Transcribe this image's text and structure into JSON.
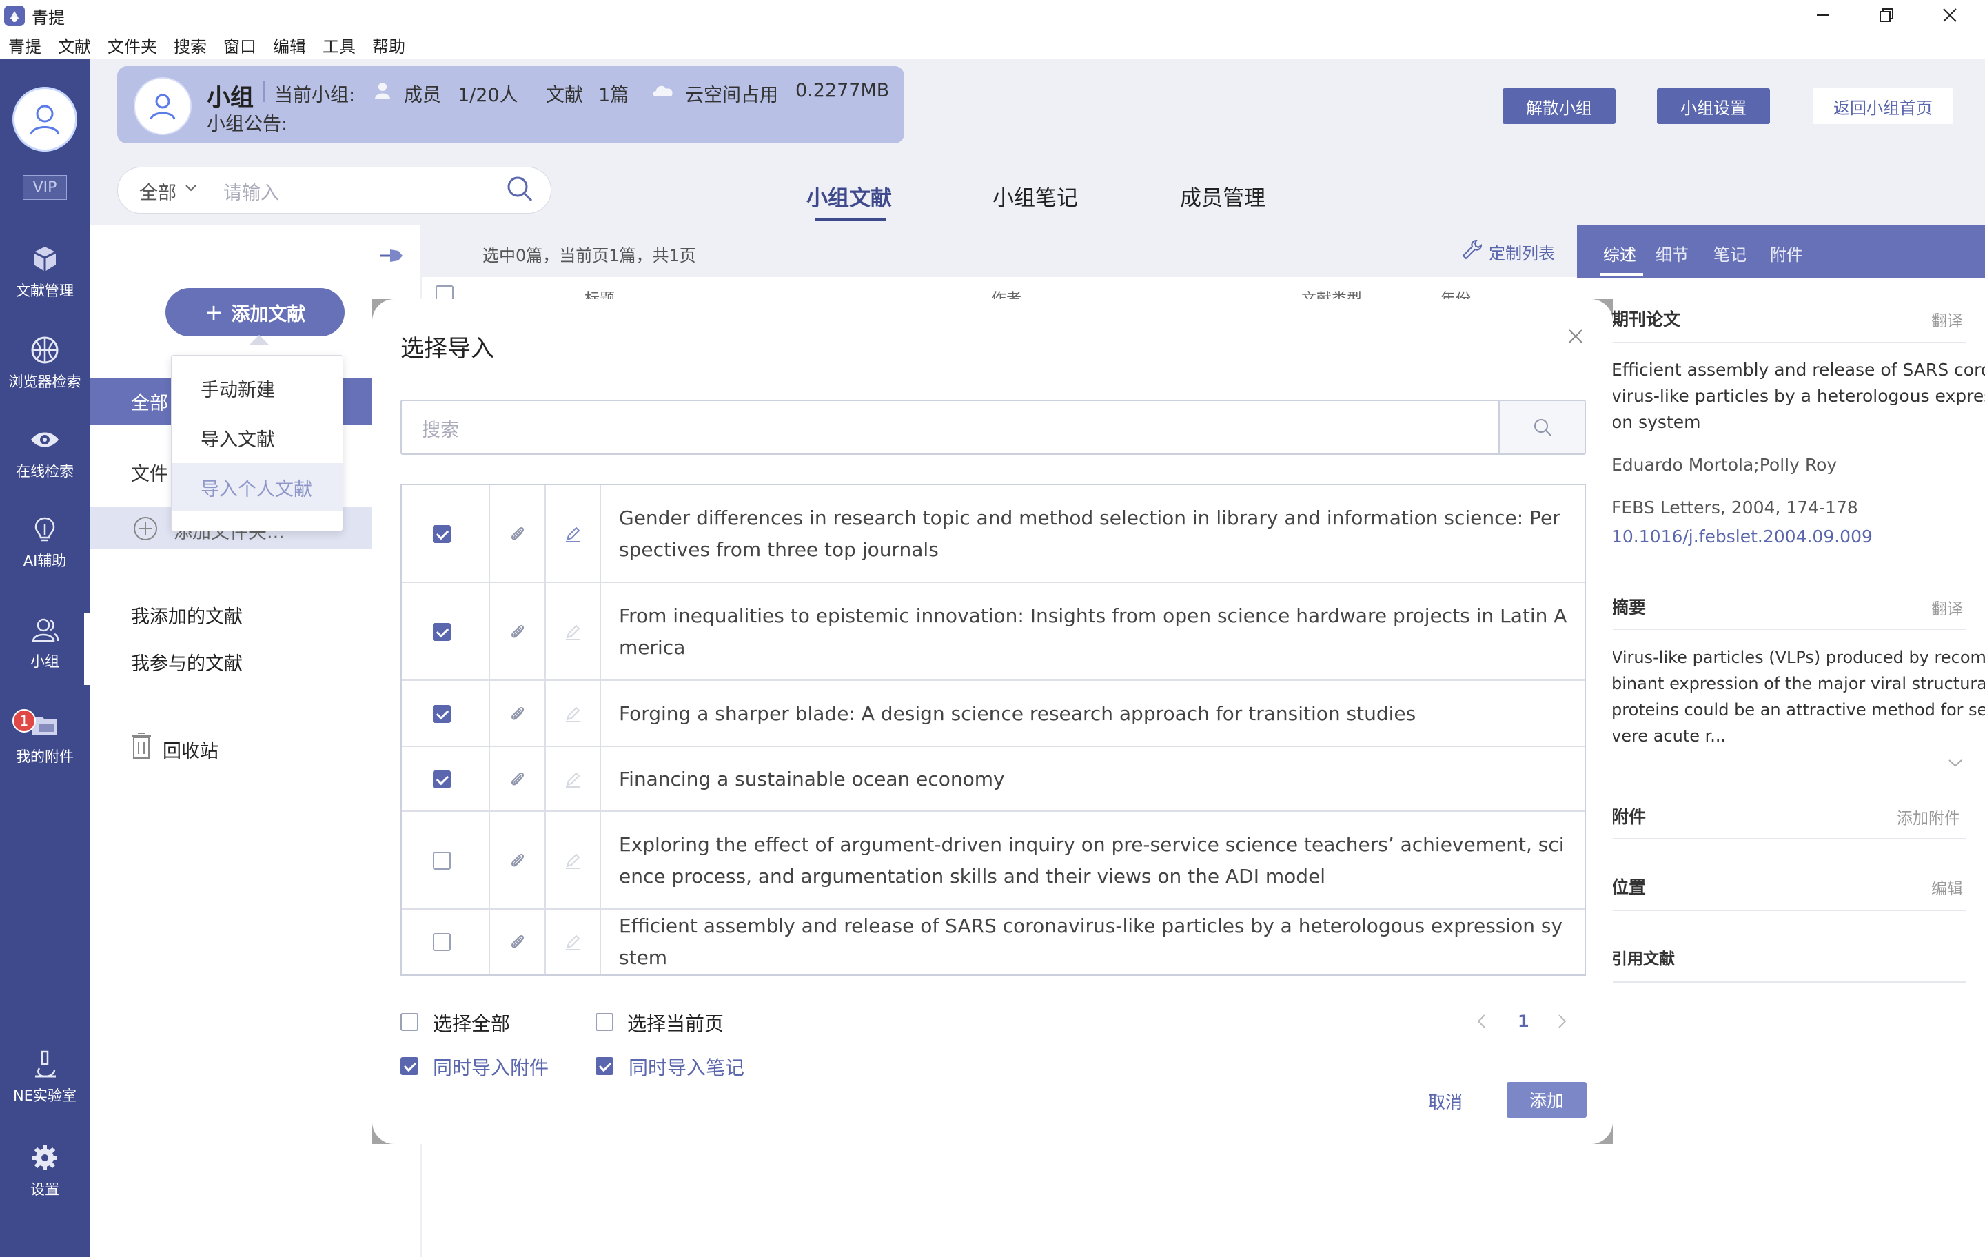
{
  "window": {
    "title": "青提"
  },
  "menu": [
    "青提",
    "文献",
    "文件夹",
    "搜索",
    "窗口",
    "编辑",
    "工具",
    "帮助"
  ],
  "nav": {
    "vip": "VIP",
    "items": [
      {
        "label": "文献管理",
        "icon": "cube-icon"
      },
      {
        "label": "浏览器检索",
        "icon": "basketball-icon"
      },
      {
        "label": "在线检索",
        "icon": "eye-icon"
      },
      {
        "label": "AI辅助",
        "icon": "bulb-icon"
      },
      {
        "label": "小组",
        "icon": "group-icon"
      },
      {
        "label": "我的附件",
        "icon": "folder-icon"
      },
      {
        "label": "NE实验室",
        "icon": "microscope-icon"
      },
      {
        "label": "设置",
        "icon": "gear-icon"
      }
    ],
    "attachments_badge": "1"
  },
  "group": {
    "name": "小组",
    "current_label": "当前小组:",
    "members_label": "成员",
    "members_value": "1/20人",
    "docs_label": "文献",
    "docs_value": "1篇",
    "cloud_label": "云空间占用",
    "cloud_value": "0.2277MB",
    "notice_label": "小组公告:"
  },
  "actions": {
    "dissolve": "解散小组",
    "settings": "小组设置",
    "home": "返回小组首页"
  },
  "search": {
    "scope": "全部",
    "placeholder": "请输入"
  },
  "tabs": [
    "小组文献",
    "小组笔记",
    "成员管理"
  ],
  "folders": {
    "add_button": "添加文献",
    "all": "全部",
    "file": "文件",
    "add_folder": "添加文件夹...",
    "my_added": "我添加的文献",
    "my_joined": "我参与的文献",
    "trash": "回收站"
  },
  "add_menu": [
    "手动新建",
    "导入文献",
    "导入个人文献"
  ],
  "list": {
    "info": "选中0篇，当前页1篇，共1页",
    "customize": "定制列表",
    "columns": [
      "标题",
      "作者",
      "文献类型",
      "年份"
    ]
  },
  "right_panel": {
    "tabs": [
      "综述",
      "细节",
      "笔记",
      "附件"
    ],
    "section_type": "期刊论文",
    "translate": "翻译",
    "title_lines": [
      "Efficient assembly and release of SARS corona",
      "virus-like particles by a heterologous expressi",
      "on system"
    ],
    "authors": "Eduardo Mortola;Polly Roy",
    "journal": "FEBS Letters",
    "year": "2004",
    "pages": "174-178",
    "doi": "10.1016/j.febslet.2004.09.009",
    "abstract_label": "摘要",
    "abstract_lines": [
      "Virus-like particles (VLPs) produced by recom",
      "binant expression of the major viral structural",
      "proteins could be an attractive method for se",
      "vere acute r..."
    ],
    "attachment_label": "附件",
    "add_attachment": "添加附件",
    "location_label": "位置",
    "edit": "编辑",
    "cited_label": "引用文献"
  },
  "modal": {
    "title": "选择导入",
    "search_placeholder": "搜索",
    "rows": [
      {
        "checked": true,
        "note_active": true,
        "title": "Gender differences in research topic and method selection in library and information science: Perspectives from three top journals"
      },
      {
        "checked": true,
        "note_active": false,
        "title": "From inequalities to epistemic innovation: Insights from open science hardware projects in Latin America"
      },
      {
        "checked": true,
        "note_active": false,
        "title": "Forging a sharper blade: A design science research approach for transition studies"
      },
      {
        "checked": true,
        "note_active": false,
        "title": "Financing a sustainable ocean economy"
      },
      {
        "checked": false,
        "note_active": false,
        "title": "Exploring the effect of argument-driven inquiry on pre-service science teachers’ achievement, science process, and argumentation skills and their views on the ADI model"
      },
      {
        "checked": false,
        "note_active": false,
        "title": "Efficient assembly and release of SARS coronavirus-like particles by a heterologous expression system"
      }
    ],
    "select_all": "选择全部",
    "select_page": "选择当前页",
    "import_attachments": "同时导入附件",
    "import_notes": "同时导入笔记",
    "page": "1",
    "cancel": "取消",
    "add": "添加"
  },
  "colors": {
    "nav": "#3f4a8c",
    "accent": "#5a66ad",
    "group_card": "#b8c0e6"
  }
}
